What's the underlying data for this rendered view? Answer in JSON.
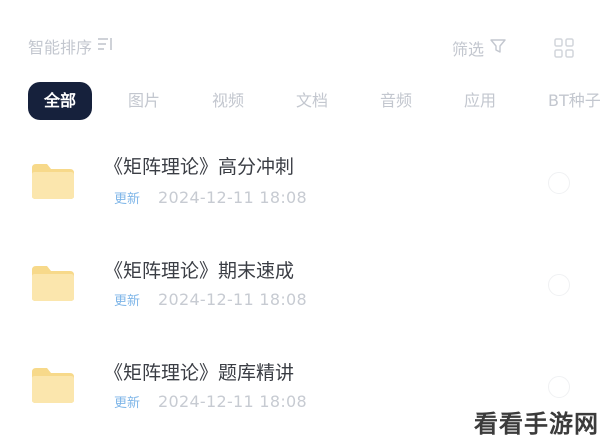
{
  "toolbar": {
    "sort_label": "智能排序",
    "sort_icon": "≡↓",
    "filter_label": "筛选"
  },
  "tabs": [
    {
      "label": "全部",
      "active": true
    },
    {
      "label": "图片",
      "active": false
    },
    {
      "label": "视频",
      "active": false
    },
    {
      "label": "文档",
      "active": false
    },
    {
      "label": "音频",
      "active": false
    },
    {
      "label": "应用",
      "active": false
    },
    {
      "label": "BT种子",
      "active": false
    }
  ],
  "files": [
    {
      "name": "《矩阵理论》高分冲刺",
      "badge": "更新",
      "date": "2024-12-11  18:08"
    },
    {
      "name": "《矩阵理论》期末速成",
      "badge": "更新",
      "date": "2024-12-11  18:08"
    },
    {
      "name": "《矩阵理论》题库精讲",
      "badge": "更新",
      "date": "2024-12-11  18:08"
    }
  ],
  "watermark": "看看手游网",
  "colors": {
    "active_tab_bg": "#16213c",
    "badge": "#7fb6e8",
    "folder": "#fbe3a4",
    "muted_text": "#c3c7cf"
  }
}
